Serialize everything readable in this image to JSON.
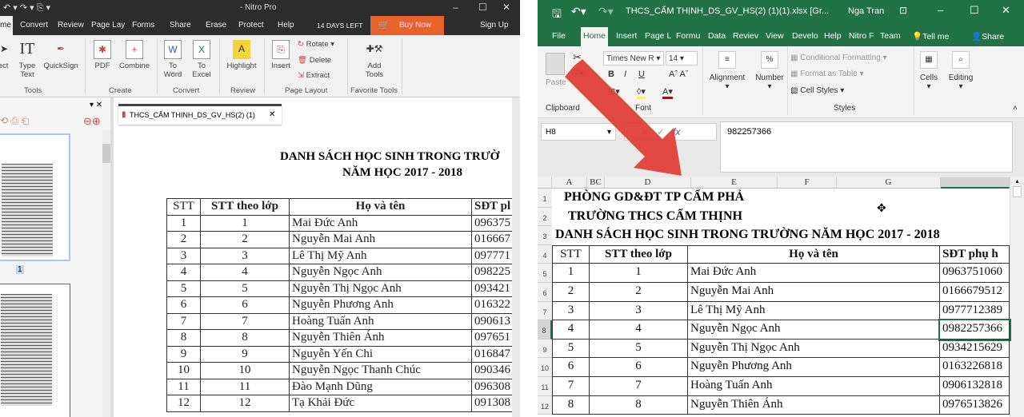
{
  "nitro": {
    "title": "- Nitro Pro",
    "tabs": [
      "me",
      "Convert",
      "Review",
      "Page Lay",
      "Forms",
      "Share",
      "Erase",
      "Protect",
      "Help"
    ],
    "trial": "14 DAYS LEFT",
    "buy": "Buy Now",
    "signup": "Sign Up",
    "ribbon": {
      "select": "ect",
      "type_text": "Type Text",
      "quicksign": "QuickSign",
      "tools_group": "Tools",
      "pdf": "PDF",
      "combine": "Combine",
      "create_group": "Create",
      "to_word": "To Word",
      "to_excel": "To Excel",
      "convert_group": "Convert",
      "highlight": "Highlight",
      "review_group": "Review",
      "insert": "Insert",
      "rotate": "Rotate",
      "delete": "Delete",
      "extract": "Extract",
      "page_layout_group": "Page Layout",
      "add_tools": "Add Tools",
      "favorite_group": "Favorite Tools"
    },
    "thumb_page": "1",
    "doc_tab": "THCS_CẨM THỊNH_DS_GV_HS(2) (1)",
    "doc_title1": "DANH SÁCH HỌC SINH TRONG TRƯỜ",
    "doc_title2": "NĂM HỌC 2017 - 2018",
    "headers": [
      "STT",
      "STT theo lớp",
      "Họ và tên",
      "SĐT pl"
    ],
    "rows": [
      [
        "1",
        "1",
        "Mai Đức Anh",
        "096375"
      ],
      [
        "2",
        "2",
        "Nguyễn Mai Anh",
        "016667"
      ],
      [
        "3",
        "3",
        "Lê Thị Mỹ Anh",
        "097771"
      ],
      [
        "4",
        "4",
        "Nguyễn Ngọc Anh",
        "098225"
      ],
      [
        "5",
        "5",
        "Nguyễn Thị Ngọc Anh",
        "093421"
      ],
      [
        "6",
        "6",
        "Nguyễn Phương Anh",
        "016322"
      ],
      [
        "7",
        "7",
        "Hoàng Tuấn Anh",
        "090613"
      ],
      [
        "8",
        "8",
        "Nguyễn Thiên Ánh",
        "097651"
      ],
      [
        "9",
        "9",
        "Nguyễn Yến Chi",
        "016847"
      ],
      [
        "10",
        "10",
        "Nguyễn Ngọc Thanh Chúc",
        "090346"
      ],
      [
        "11",
        "11",
        "Đào Mạnh Dũng",
        "096308"
      ],
      [
        "12",
        "12",
        "Tạ Khải Đức",
        "091308"
      ]
    ]
  },
  "excel": {
    "title": "THCS_CẨM THỊNH_DS_GV_HS(2) (1)(1).xlsx [Gr...",
    "user": "Nga Tran",
    "tabs": [
      "File",
      "Home",
      "Insert",
      "Page L",
      "Formu",
      "Data",
      "Reviev",
      "View",
      "Develo",
      "Help",
      "Nitro F",
      "Team",
      "Tell me",
      "Share"
    ],
    "ribbon": {
      "paste": "Paste",
      "font_name": "Times New R",
      "font_size": "14",
      "bold": "B",
      "italic": "I",
      "underline": "U",
      "clipboard": "Clipboard",
      "font_group": "Font",
      "alignment": "Alignment",
      "number": "Number",
      "cond_fmt": "Conditional Formatting",
      "fmt_table": "Format as Table",
      "cell_styles": "Cell Styles",
      "styles_group": "Styles",
      "cells": "Cells",
      "editing": "Editing"
    },
    "name_box": "H8",
    "formula": "982257366",
    "columns": [
      "A",
      "BC",
      "D",
      "E",
      "F",
      "G"
    ],
    "row_numbers": [
      "1",
      "2",
      "3",
      "4",
      "5",
      "6",
      "7",
      "8",
      "9",
      "10",
      "11",
      "12"
    ],
    "line1": "PHÒNG GD&ĐT TP CẨM PHẢ",
    "line2": "TRƯỜNG THCS CẨM THỊNH",
    "line3": "DANH SÁCH HỌC SINH TRONG TRƯỜNG NĂM HỌC 2017 - 2018",
    "headers": [
      "STT",
      "STT theo lớp",
      "Họ và tên",
      "SĐT phụ h"
    ],
    "rows": [
      [
        "1",
        "1",
        "Mai Đức Anh",
        "0963751060"
      ],
      [
        "2",
        "2",
        "Nguyễn Mai Anh",
        "0166679512"
      ],
      [
        "3",
        "3",
        "Lê Thị Mỹ Anh",
        "0977712389"
      ],
      [
        "4",
        "4",
        "Nguyễn Ngọc Anh",
        "0982257366"
      ],
      [
        "5",
        "5",
        "Nguyễn Thị Ngọc Anh",
        "0934215629"
      ],
      [
        "6",
        "6",
        "Nguyễn Phương Anh",
        "0163226818"
      ],
      [
        "7",
        "7",
        "Hoàng Tuấn Anh",
        "0906132818"
      ],
      [
        "8",
        "8",
        "Nguyễn Thiên Ánh",
        "0976513826"
      ]
    ],
    "selected_cell": "H8"
  },
  "colors": {
    "nitro_dark": "#2d2d2d",
    "nitro_accent": "#e8622c",
    "excel_green": "#217346",
    "arrow": "#e03a32"
  }
}
